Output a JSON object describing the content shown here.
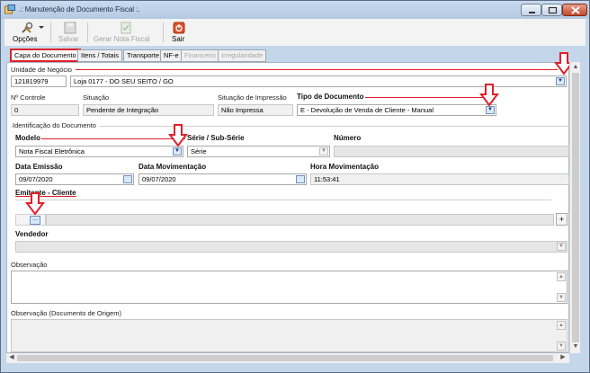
{
  "window": {
    "title": ".: Manutenção de Documento Fiscal :."
  },
  "toolbar": {
    "opcoes": "Opções",
    "salvar": "Salvar",
    "gerar_nota": "Gerar Nota Fiscal",
    "sair": "Sair"
  },
  "tabs": [
    {
      "label": "Capa do Documento",
      "state": "active"
    },
    {
      "label": "Itens / Totais",
      "state": "enabled"
    },
    {
      "label": "Transporte",
      "state": "enabled"
    },
    {
      "label": "NF-e",
      "state": "enabled"
    },
    {
      "label": "Financeiro",
      "state": "disabled"
    },
    {
      "label": "Irregularidade",
      "state": "disabled"
    }
  ],
  "unidade": {
    "label": "Unidade de Negócio",
    "code": "121819979",
    "name": "Loja 0177 - DO SEU SEITO / GO"
  },
  "controle": {
    "label": "Nº Controle",
    "value": "0"
  },
  "situacao": {
    "label": "Situação",
    "value": "Pendente de Integração"
  },
  "situacao_impressao": {
    "label": "Situação de Impressão",
    "value": "Não Impressa"
  },
  "tipo_documento": {
    "label": "Tipo de Documento",
    "value": "E - Devolução de Venda de Cliente - Manual"
  },
  "identificacao": {
    "label": "Identificação do Documento"
  },
  "modelo": {
    "label": "Modelo",
    "value": "Nota Fiscal Eletrônica"
  },
  "serie": {
    "label": "Série / Sub-Série",
    "value": "Série"
  },
  "numero": {
    "label": "Número",
    "value": ""
  },
  "data_emissao": {
    "label": "Data Emissão",
    "value": "09/07/2020"
  },
  "data_movimentacao": {
    "label": "Data Movimentação",
    "value": "09/07/2020"
  },
  "hora_movimentacao": {
    "label": "Hora Movimentação",
    "value": "11:53:41"
  },
  "emitente": {
    "label": "Emitente - Cliente",
    "lookup_button": "...",
    "add_button": "+"
  },
  "vendedor": {
    "label": "Vendedor"
  },
  "observacao": {
    "label": "Observação"
  },
  "observacao_origem": {
    "label": "Observação (Documento de Origem)"
  },
  "colors": {
    "annotation_red": "#e0202a",
    "window_frame": "#c4d6ea"
  }
}
